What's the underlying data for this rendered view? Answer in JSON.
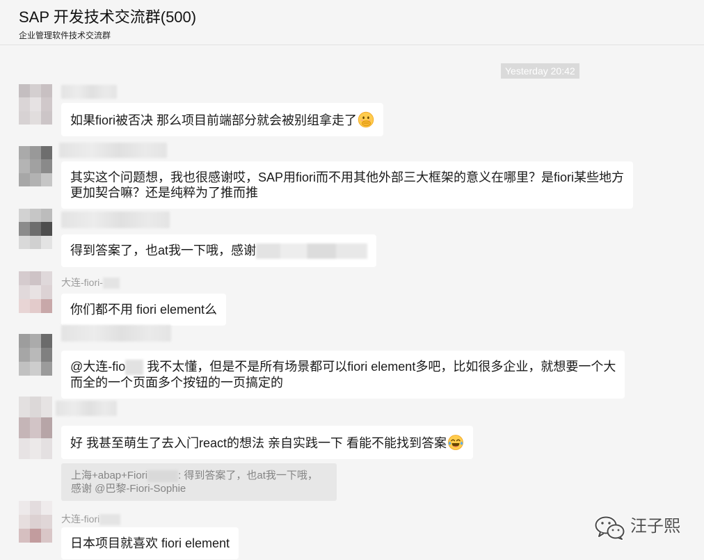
{
  "theme": {
    "background": "#f5f5f5",
    "bubble": "#ffffff",
    "timestamp_bg": "#dadada",
    "sender_text": "#9b9b9b",
    "quote_bg": "#e7e7e7"
  },
  "header": {
    "title": "SAP 开发技术交流群(500)",
    "subtitle": "企业管理软件技术交流群"
  },
  "timestamp": "Yesterday 20:42",
  "messages": [
    {
      "lines": [
        "如果fiori被否决 那么项目前端部分就会被别组拿走了"
      ],
      "emoji": "face-with-hand-over-mouth-icon"
    },
    {
      "lines": [
        "其实这个问题想，我也很感谢哎，SAP用fiori而不用其他外部三大框架的意义在哪里？是fiori某些地方",
        "更加契合嘛？还是纯粹为了推而推"
      ]
    },
    {
      "lines": [
        "得到答案了，也at我一下哦，感谢"
      ]
    },
    {
      "sender": "大连-fiori-",
      "lines": [
        "你们都不用 fiori element么"
      ]
    },
    {
      "mention": "@大连-fio",
      "lines": [
        " 我不太懂，但是不是所有场景都可以fiori element多吧，比如很多企业，就想要一个大",
        "而全的一个页面多个按钮的一页搞定的"
      ]
    },
    {
      "lines": [
        "好 我甚至萌生了去入门react的想法 亲自实践一下 看能不能找到答案"
      ],
      "emoji": "face-with-tears-of-joy-icon",
      "quote": {
        "sender": "上海+abap+Fiori",
        "lines": [
          ": 得到答案了，也at我一下哦，",
          "感谢 @巴黎-Fiori-Sophie"
        ]
      }
    },
    {
      "sender": "大连-fiori",
      "lines": [
        "日本项目就喜欢 fiori element"
      ]
    }
  ],
  "watermark": {
    "icon": "wechat-icon",
    "text": "汪子熙"
  }
}
